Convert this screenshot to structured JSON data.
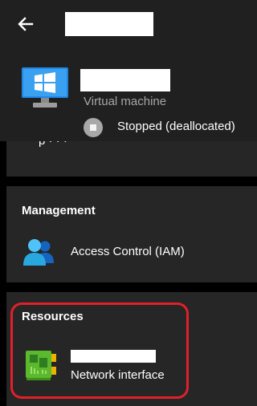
{
  "header": {
    "back_icon": "back-arrow-icon",
    "title_redacted": true,
    "resource_name_redacted": true,
    "resource_icon": "virtual-machine-icon",
    "resource_type": "Virtual machine",
    "status_icon": "stopped-status-icon",
    "status": "Stopped (deallocated)"
  },
  "management": {
    "title": "Management",
    "items": [
      {
        "icon": "access-control-iam-icon",
        "label": "Access Control (IAM)"
      }
    ]
  },
  "resources": {
    "title": "Resources",
    "items": [
      {
        "icon": "network-interface-icon",
        "name_redacted": true,
        "label": "Network interface"
      }
    ]
  },
  "colors": {
    "header_bg": "#202020",
    "card_bg": "#262626",
    "page_bg": "#000000",
    "highlight": "#e0202a",
    "vm_blue": "#1e88e5"
  }
}
